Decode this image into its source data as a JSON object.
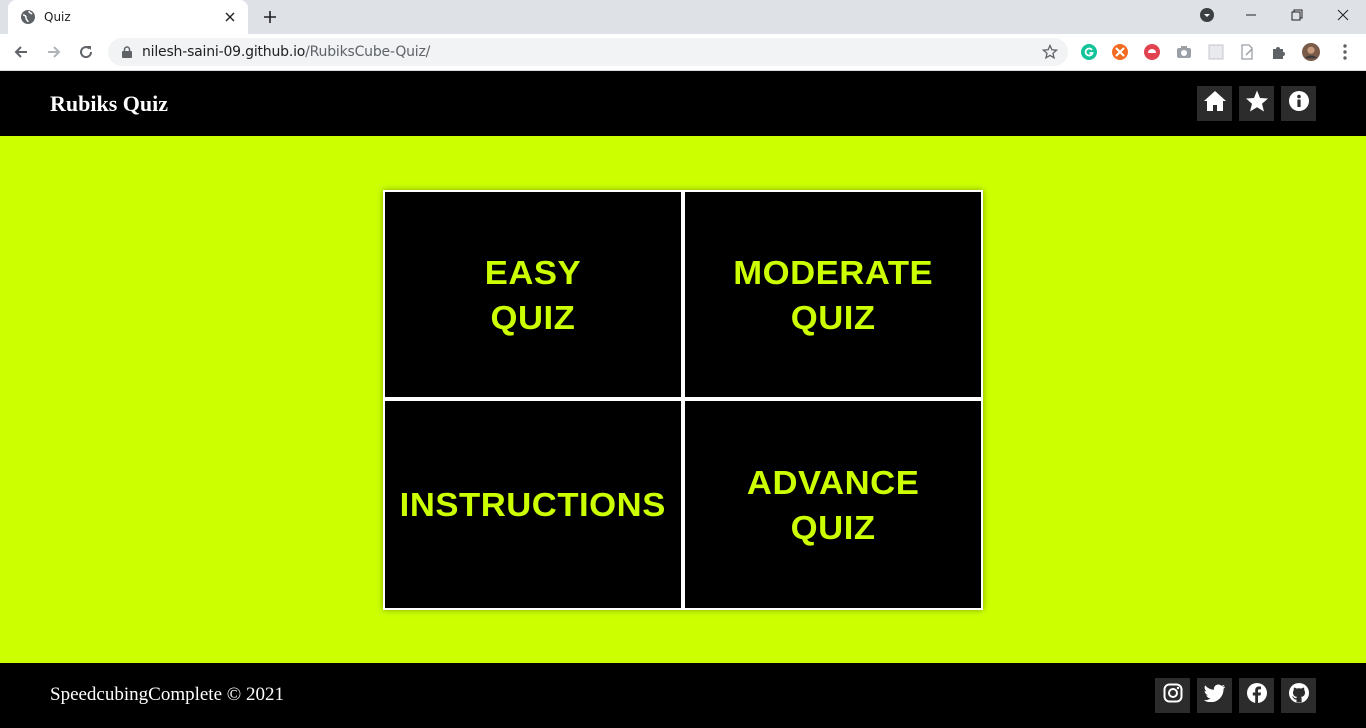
{
  "browser": {
    "tab_title": "Quiz",
    "url_host": "nilesh-saini-09.github.io",
    "url_path": "/RubiksCube-Quiz/"
  },
  "header": {
    "brand": "Rubiks Quiz",
    "buttons": [
      "home-icon",
      "star-icon",
      "info-icon"
    ]
  },
  "grid": {
    "cells": [
      {
        "label": "EASY\nQUIZ"
      },
      {
        "label": "MODERATE\nQUIZ"
      },
      {
        "label": "INSTRUCTIONS"
      },
      {
        "label": "ADVANCE\nQUIZ"
      }
    ]
  },
  "footer": {
    "copyright": "SpeedcubingComplete © 2021",
    "social": [
      "instagram-icon",
      "twitter-icon",
      "facebook-icon",
      "github-icon"
    ]
  },
  "colors": {
    "accent": "#ccff00",
    "bar": "#000000",
    "button": "#2c2c2c"
  }
}
